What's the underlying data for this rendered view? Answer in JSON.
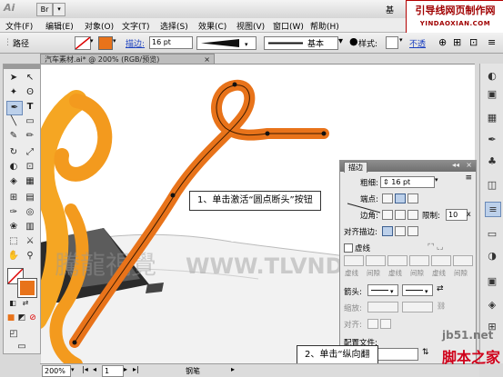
{
  "app": {
    "logo": "Ai",
    "bridge_btn": "Br",
    "workspace_label": "基"
  },
  "watermark": {
    "title": "引导线网页制作网",
    "url": "YINDAOXIAN.COM"
  },
  "menu": [
    "文件(F)",
    "编辑(E)",
    "对象(O)",
    "文字(T)",
    "选择(S)",
    "效果(C)",
    "视图(V)",
    "窗口(W)",
    "帮助(H)"
  ],
  "control": {
    "path_label": "路径",
    "stroke_label": "描边:",
    "stroke_value": "16 pt",
    "profile_label": "基本",
    "style_label": "样式:",
    "opacity_label": "不透"
  },
  "doc_tab": "汽车素材.ai* @ 200% (RGB/预览)",
  "stroke_panel": {
    "tab": "描边",
    "weight_label": "粗细:",
    "weight_value": "16 pt",
    "cap_label": "端点:",
    "corner_label": "边角:",
    "limit_label": "限制:",
    "limit_value": "10",
    "align_label": "对齐描边:",
    "dashed_label": "虚线",
    "dash_labels": [
      "虚线",
      "间隙",
      "虚线",
      "间隙",
      "虚线",
      "间隙"
    ],
    "arrow_label": "箭头:",
    "scale_label": "缩放:",
    "align2_label": "对齐:",
    "profile_label": "配置文件:"
  },
  "callouts": {
    "c1": "1、单击激活“圆点断头”按钮",
    "c2": "2、单击“纵向翻"
  },
  "status": {
    "zoom": "200%",
    "page": "1",
    "tool": "钢笔"
  },
  "site": {
    "a": "jb51.net",
    "b": "脚本之家"
  },
  "canvas_watermark": "騰龍視覺 WWW.TLVNDT",
  "colors": {
    "path_orange": "#e8731a",
    "swirl_orange": "#f39a1e"
  }
}
